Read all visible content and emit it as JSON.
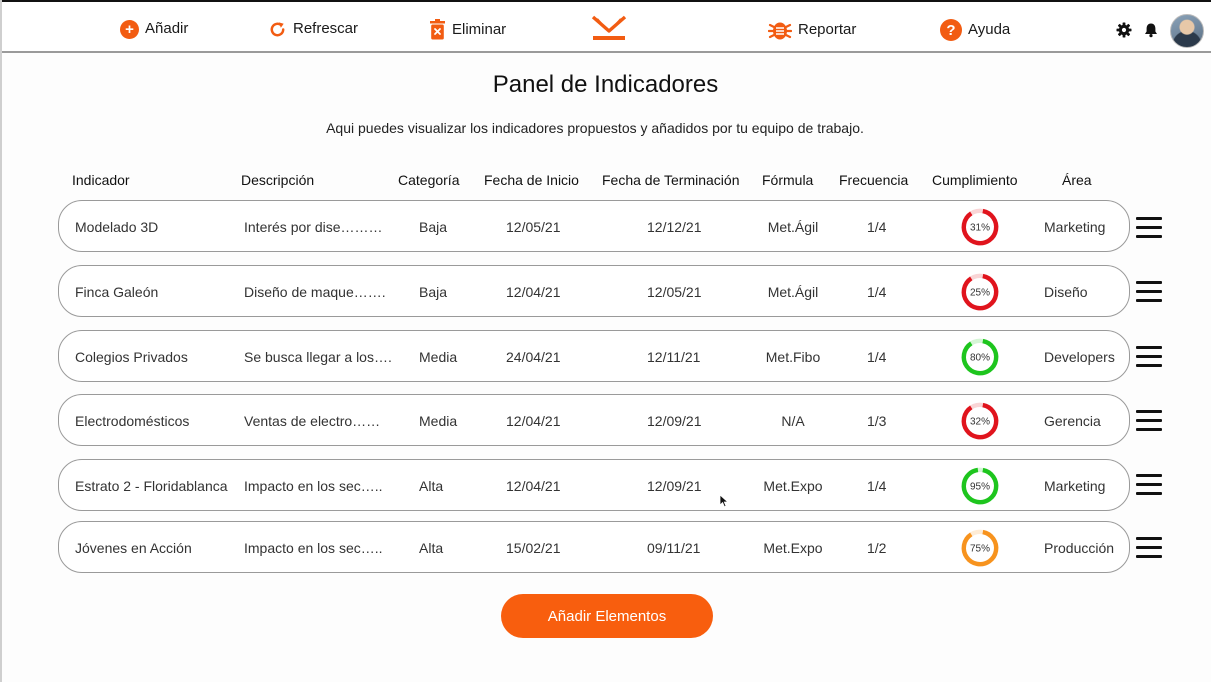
{
  "toolbar": {
    "add_label": "Añadir",
    "refresh_label": "Refrescar",
    "delete_label": "Eliminar",
    "report_label": "Reportar",
    "help_label": "Ayuda"
  },
  "colors": {
    "accent": "#f25c12",
    "status_low": "#e0141d",
    "status_high": "#1ec51e",
    "status_mid": "#f7931e"
  },
  "page": {
    "title": "Panel de Indicadores",
    "subtitle": "Aqui puedes visualizar los indicadores propuestos y añadidos por tu equipo de trabajo."
  },
  "table": {
    "headers": [
      "Indicador",
      "Descripción",
      "Categoría",
      "Fecha de Inicio",
      "Fecha de Terminación",
      "Fórmula",
      "Frecuencia",
      "Cumplimiento",
      "Área"
    ],
    "rows": [
      {
        "indicador": "Modelado 3D",
        "descripcion": "Interés por dise………",
        "categoria": "Baja",
        "inicio": "12/05/21",
        "fin": "12/12/21",
        "formula": "Met.Ágil",
        "frecuencia": "1/4",
        "cumplimiento": 31,
        "cumplimiento_label": "31%",
        "area": "Marketing",
        "status": "low"
      },
      {
        "indicador": "Finca Galeón",
        "descripcion": "Diseño de maque…….",
        "categoria": "Baja",
        "inicio": "12/04/21",
        "fin": "12/05/21",
        "formula": "Met.Ágil",
        "frecuencia": "1/4",
        "cumplimiento": 25,
        "cumplimiento_label": "25%",
        "area": "Diseño",
        "status": "low"
      },
      {
        "indicador": "Colegios Privados",
        "descripcion": "Se busca llegar a los….",
        "categoria": "Media",
        "inicio": "24/04/21",
        "fin": "12/11/21",
        "formula": "Met.Fibo",
        "frecuencia": "1/4",
        "cumplimiento": 80,
        "cumplimiento_label": "80%",
        "area": "Developers",
        "status": "high"
      },
      {
        "indicador": "Electrodomésticos",
        "descripcion": "Ventas de electro……",
        "categoria": "Media",
        "inicio": "12/04/21",
        "fin": "12/09/21",
        "formula": "N/A",
        "frecuencia": "1/3",
        "cumplimiento": 32,
        "cumplimiento_label": "32%",
        "area": "Gerencia",
        "status": "low"
      },
      {
        "indicador": "Estrato 2 - Floridablanca",
        "descripcion": "Impacto en los sec…..",
        "categoria": "Alta",
        "inicio": "12/04/21",
        "fin": "12/09/21",
        "formula": "Met.Expo",
        "frecuencia": "1/4",
        "cumplimiento": 95,
        "cumplimiento_label": "95%",
        "area": "Marketing",
        "status": "high"
      },
      {
        "indicador": "Jóvenes en Acción",
        "descripcion": "Impacto en los sec…..",
        "categoria": "Alta",
        "inicio": "15/02/21",
        "fin": "09/11/21",
        "formula": "Met.Expo",
        "frecuencia": "1/2",
        "cumplimiento": 75,
        "cumplimiento_label": "75%",
        "area": "Producción",
        "status": "mid"
      }
    ]
  },
  "add_elements_label": "Añadir Elementos",
  "icons": {
    "add": "plus-circle-icon",
    "refresh": "refresh-icon",
    "delete": "trash-icon",
    "logo": "brand-logo-icon",
    "report": "bug-icon",
    "help": "help-circle-icon",
    "settings": "gear-icon",
    "notifications": "bell-icon",
    "row_menu": "hamburger-menu-icon"
  }
}
